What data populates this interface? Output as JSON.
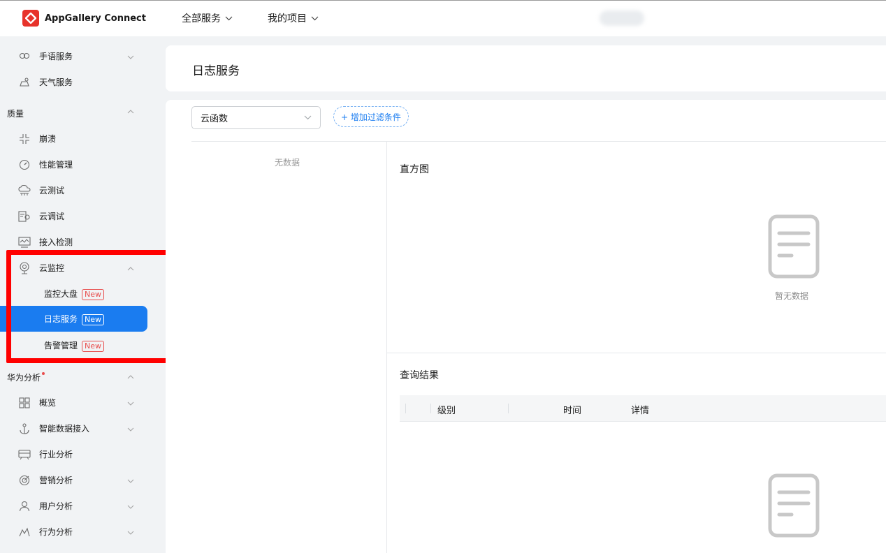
{
  "topbar": {
    "app_name": "AppGallery Connect",
    "nav": [
      {
        "label": "全部服务"
      },
      {
        "label": "我的项目"
      }
    ]
  },
  "sidebar": {
    "items_top": [
      {
        "label": "手语服务",
        "icon": "sign-language-icon",
        "has_chevron": true
      },
      {
        "label": "天气服务",
        "icon": "weather-icon",
        "has_chevron": false
      }
    ],
    "group_quality": "质量",
    "quality_items": [
      {
        "label": "崩溃",
        "icon": "crash-icon"
      },
      {
        "label": "性能管理",
        "icon": "gauge-icon"
      },
      {
        "label": "云测试",
        "icon": "cloud-test-icon"
      },
      {
        "label": "云调试",
        "icon": "cloud-debug-icon"
      },
      {
        "label": "接入检测",
        "icon": "access-check-icon"
      },
      {
        "label": "云监控",
        "icon": "cloud-monitor-icon"
      }
    ],
    "monitor_sub": [
      {
        "label": "监控大盘",
        "badge": "New",
        "active": false
      },
      {
        "label": "日志服务",
        "badge": "New",
        "active": true
      },
      {
        "label": "告警管理",
        "badge": "New",
        "active": false
      }
    ],
    "group_analytics": "华为分析",
    "analytics_items": [
      {
        "label": "概览",
        "icon": "grid-icon",
        "has_chevron": true
      },
      {
        "label": "智能数据接入",
        "icon": "anchor-icon",
        "has_chevron": true
      },
      {
        "label": "行业分析",
        "icon": "industry-icon",
        "has_chevron": false
      },
      {
        "label": "营销分析",
        "icon": "marketing-icon",
        "has_chevron": true
      },
      {
        "label": "用户分析",
        "icon": "user-icon",
        "has_chevron": true
      },
      {
        "label": "行为分析",
        "icon": "behavior-icon",
        "has_chevron": true
      }
    ]
  },
  "main": {
    "page_title": "日志服务",
    "filter_select": "云函数",
    "add_filter": "+ 增加过滤条件",
    "left_empty": "无数据",
    "histogram_title": "直方图",
    "histogram_empty": "暂无数据",
    "results_title": "查询结果",
    "table_headers": [
      "级别",
      "时间",
      "详情"
    ]
  },
  "colors": {
    "accent": "#1a7cf0",
    "brand": "#e7332b",
    "highlight": "#ff0000"
  }
}
